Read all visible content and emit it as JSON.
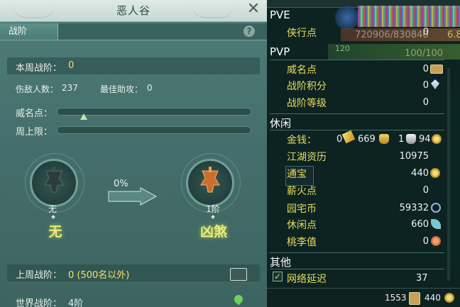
{
  "window": {
    "title": "恶人谷"
  },
  "tabs": [
    {
      "label": "战阶",
      "active": true
    }
  ],
  "help_glyph": "?",
  "close_glyph": "✕",
  "stats": {
    "week_rank_label": "本周战阶：",
    "week_rank_value": "0",
    "kills_label": "伤敌人数：",
    "kills_value": "237",
    "assists_label": "最佳助攻：",
    "assists_value": "0",
    "prestige_label": "威名点：",
    "weekly_cap_label": "周上限：",
    "prestige_progress": 0.14,
    "weekly_cap_progress": 0.0
  },
  "ranks": {
    "current_caption": "无",
    "current_name": "无",
    "progress_text": "0%",
    "next_caption": "1阶",
    "next_name": "凶煞"
  },
  "last_week": {
    "label": "上周战阶：",
    "value": "0 (500名以外)"
  },
  "world": {
    "label": "世界战阶：",
    "value": "4阶"
  },
  "icons": {
    "close": "close-icon",
    "help": "help-icon",
    "mail": "mail-icon",
    "location": "location-pin-icon"
  },
  "right": {
    "pve_title": "PVE",
    "pve_items": [
      {
        "label": "侠行点",
        "value": "0"
      }
    ],
    "pvp_title": "PVP",
    "pvp_items": [
      {
        "label": "威名点",
        "value": "0"
      },
      {
        "label": "战阶积分",
        "value": "0"
      },
      {
        "label": "战阶等级",
        "value": "0"
      }
    ],
    "leisure_title": "休闲",
    "money": {
      "label": "金钱：",
      "gold_bricks": "0",
      "gold": "669",
      "silver": "1",
      "copper": "94"
    },
    "leisure_items": [
      {
        "label": "江湖资历",
        "value": "10975"
      },
      {
        "label": "通宝",
        "value": "440"
      },
      {
        "label": "薪火点",
        "value": "0"
      },
      {
        "label": "园宅币",
        "value": "59332"
      },
      {
        "label": "休闲点",
        "value": "660"
      },
      {
        "label": "桃李值",
        "value": "0"
      }
    ],
    "other_title": "其他",
    "latency": {
      "label": "网络延迟",
      "value": "37",
      "checked": true
    },
    "bottom": {
      "pass_count": "1553",
      "coin_count": "440"
    }
  },
  "background_bleed": {
    "hp_text": "720906/830840",
    "level_text": "120",
    "mp_text": "100/100",
    "side_text": "6.8"
  },
  "colors": {
    "panel_bg": "#4a7873",
    "title_bar": "#d4e3dd",
    "accent_yellow": "#f2e36b",
    "right_bg": "#0a201e",
    "right_label": "#e9dc5a"
  }
}
